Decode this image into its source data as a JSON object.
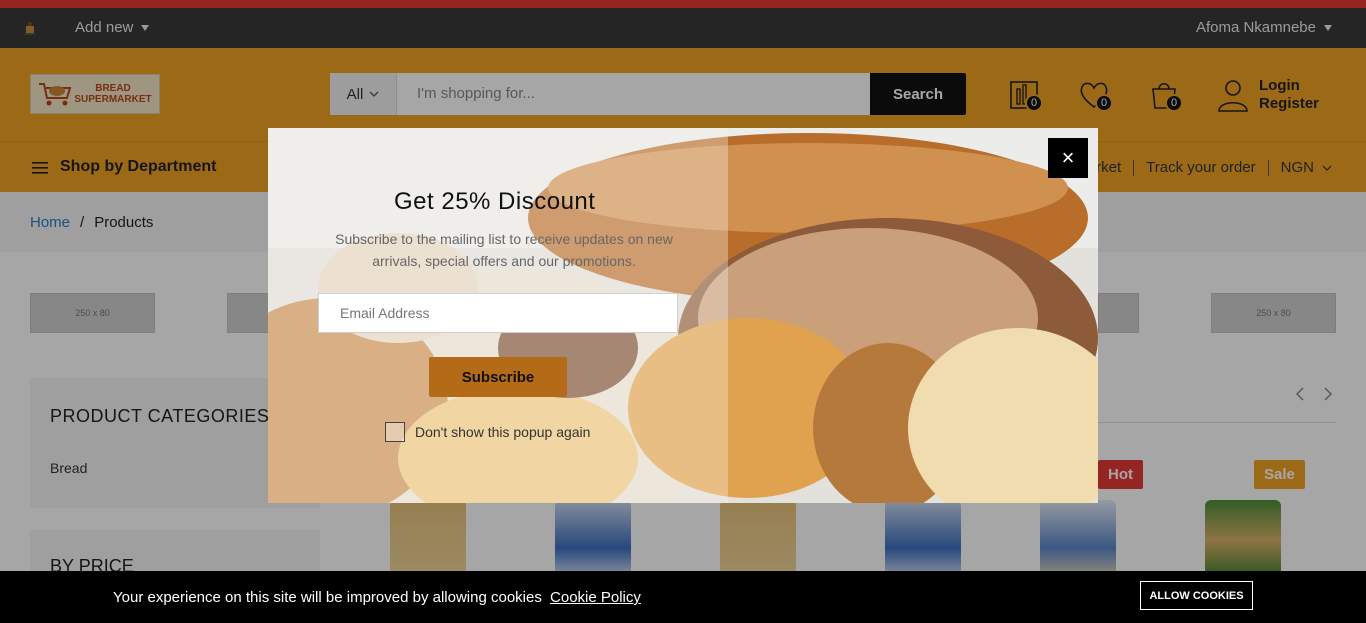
{
  "admin_bar": {
    "add_new": "Add new",
    "user_name": "Afoma Nkamnebe"
  },
  "header": {
    "logo_text_line1": "BREAD",
    "logo_text_line2": "SUPERMARKET",
    "search": {
      "category": "All",
      "placeholder": "I'm shopping for...",
      "button": "Search"
    },
    "compare_count": "0",
    "wishlist_count": "0",
    "cart_count": "0",
    "login": "Login",
    "register": "Register"
  },
  "nav": {
    "department": "Shop by Department",
    "link_partial": "rket",
    "track_order": "Track your order",
    "currency": "NGN"
  },
  "breadcrumb": {
    "home": "Home",
    "separator": "/",
    "current": "Products"
  },
  "banners": {
    "left_label": "250 x 80",
    "right_label": "250 x 80"
  },
  "sidebar": {
    "categories_title": "PRODUCT CATEGORIES",
    "category_item": "Bread",
    "price_title": "BY PRICE"
  },
  "product_tags": {
    "hot": "Hot",
    "sale": "Sale"
  },
  "popup": {
    "title": "Get 25% Discount",
    "description": "Subscribe to the mailing list to receive updates on new arrivals, special offers and our promotions.",
    "email_placeholder": "Email Address",
    "subscribe_button": "Subscribe",
    "dont_show": "Don't show this popup again",
    "close_symbol": "×"
  },
  "cookie_bar": {
    "message": "Your experience on this site will be improved by allowing cookies",
    "policy_link": "Cookie Policy",
    "allow_button": "ALLOW COOKIES"
  },
  "colors": {
    "brand": "#f0a324",
    "admin_bar": "#3a3a3a",
    "top_stripe": "#e53935",
    "subscribe": "#b46b18",
    "hot_tag": "#e53935",
    "sale_tag": "#f0a324"
  }
}
